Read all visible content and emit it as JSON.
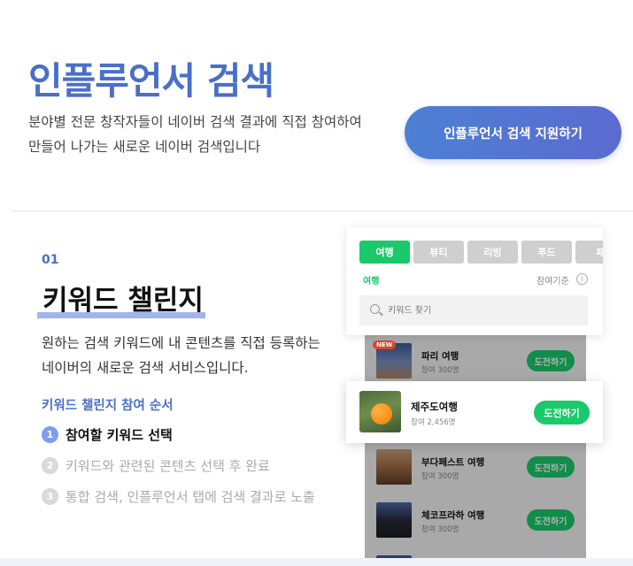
{
  "hero": {
    "title": "인플루언서 검색",
    "desc_line1": "분야별 전문 창작자들이 네이버 검색 결과에 직접 참여하여",
    "desc_line2": "만들어 나가는 새로운 네이버 검색입니다",
    "cta_label": "인플루언서 검색 지원하기"
  },
  "section": {
    "number": "01",
    "title": "키워드 챌린지",
    "desc_line1": "원하는 검색 키워드에 내 콘텐츠를 직접 등록하는",
    "desc_line2": "네이버의 새로운 검색 서비스입니다.",
    "steps_title": "키워드 챌린지 참여 순서",
    "steps": [
      {
        "num": "1",
        "text": "참여할 키워드 선택"
      },
      {
        "num": "2",
        "text": "키워드와 관련된 콘텐츠 선택 후 완료"
      },
      {
        "num": "3",
        "text": "통합 검색, 인플루언서 탭에 검색 결과로 노출"
      }
    ]
  },
  "search_card": {
    "tabs": [
      "여행",
      "뷰티",
      "리빙",
      "푸드",
      "패"
    ],
    "sub_label": "여행",
    "sort_label": "참여기준",
    "info_icon": "i",
    "search_placeholder": "키워드 찾기"
  },
  "list": {
    "new_badge": "NEW",
    "items": [
      {
        "name": "파리 여행",
        "count": "참여 300명",
        "button": "도전하기"
      },
      {
        "name": "부다페스트 여행",
        "count": "참여 300명",
        "button": "도전하기"
      },
      {
        "name": "체코프라하 여행",
        "count": "참여 300명",
        "button": "도전하기"
      }
    ]
  },
  "highlight": {
    "name": "제주도여행",
    "count": "참여 2,456명",
    "button": "도전하기"
  },
  "colors": {
    "brand_blue": "#4a6fc8",
    "naver_green": "#19c96a"
  }
}
